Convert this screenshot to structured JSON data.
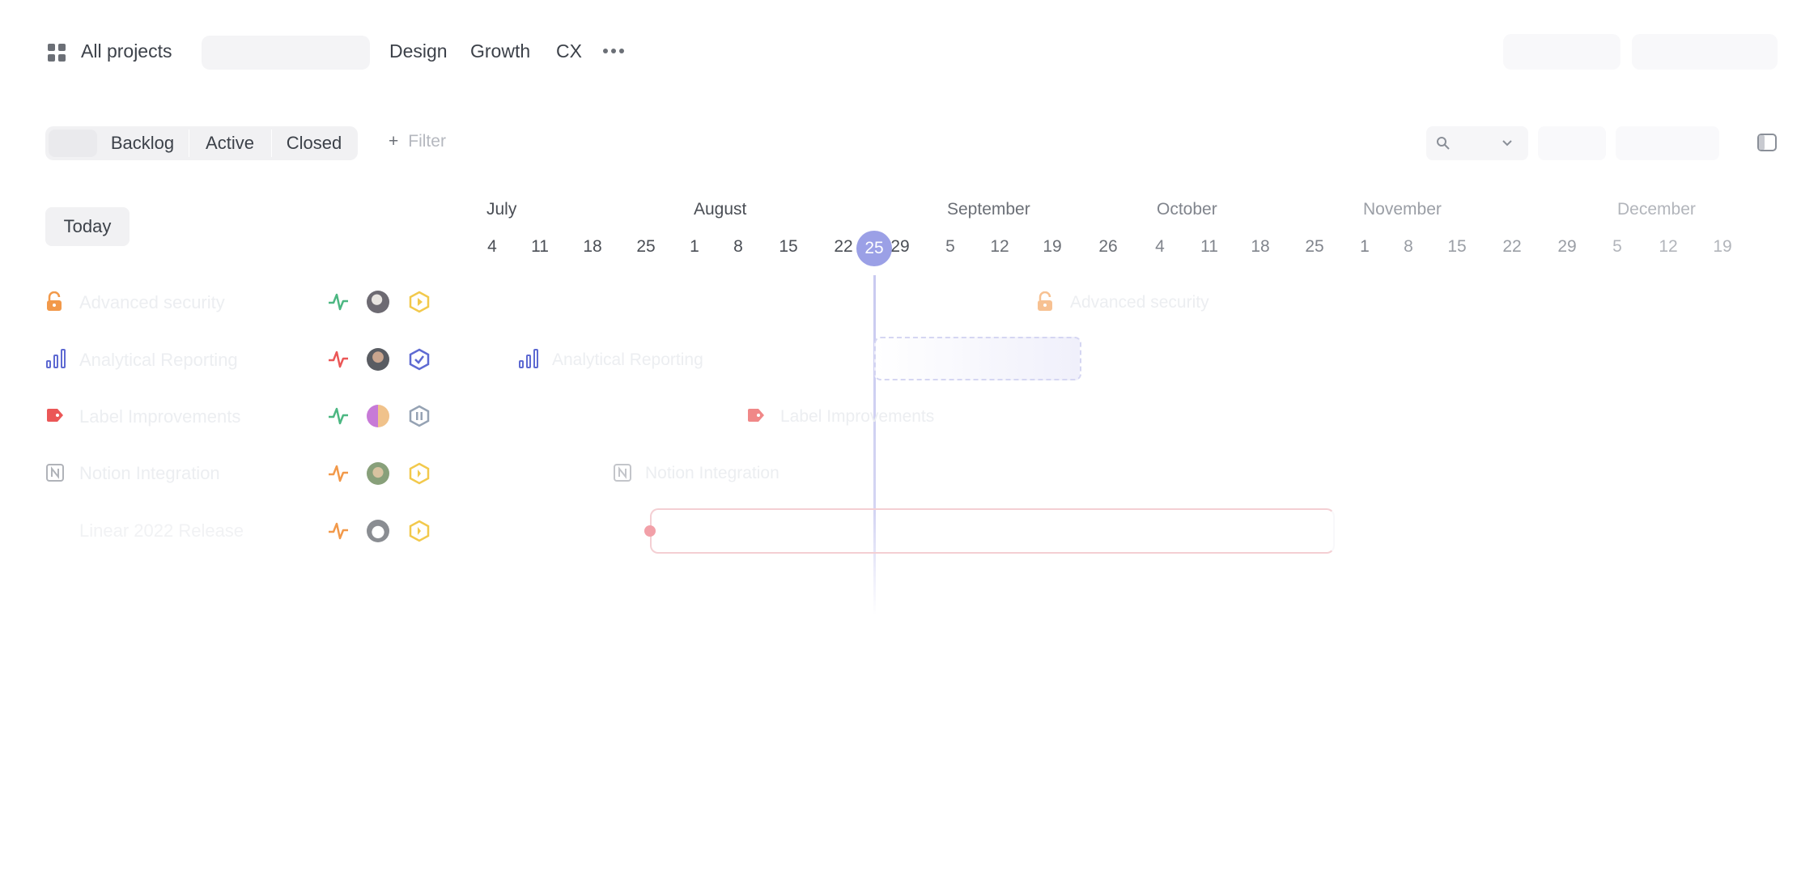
{
  "header": {
    "all_projects_label": "All projects",
    "tabs": [
      "Design",
      "Growth",
      "CX"
    ],
    "more_label": "•••"
  },
  "toolbar": {
    "segments": [
      "Backlog",
      "Active",
      "Closed"
    ],
    "filter_label": "Filter",
    "filter_plus": "+"
  },
  "timeline": {
    "today_button": "Today",
    "months": [
      "July",
      "August",
      "September",
      "October",
      "November",
      "December"
    ],
    "dates": [
      "4",
      "11",
      "18",
      "25",
      "1",
      "8",
      "15",
      "22",
      "25",
      "29",
      "5",
      "12",
      "19",
      "26",
      "4",
      "11",
      "18",
      "25",
      "1",
      "8",
      "15",
      "22",
      "29",
      "5",
      "12",
      "19"
    ],
    "today_label": "25"
  },
  "projects": [
    {
      "name": "Advanced security",
      "icon": "lock-icon",
      "health": "on-track",
      "status": "in-progress"
    },
    {
      "name": "Analytical Reporting",
      "icon": "bar-chart-icon",
      "health": "off-track",
      "status": "completed"
    },
    {
      "name": "Label Improvements",
      "icon": "label-icon",
      "health": "on-track",
      "status": "paused"
    },
    {
      "name": "Notion Integration",
      "icon": "notion-icon",
      "health": "at-risk",
      "status": "in-progress"
    },
    {
      "name": "Linear 2022 Release",
      "icon": "",
      "health": "at-risk",
      "status": "in-progress"
    }
  ],
  "colors": {
    "accent": "#9ba0e6",
    "on_track": "#4cb782",
    "off_track": "#eb5757",
    "at_risk": "#f2994a",
    "status_yellow": "#f2c94c",
    "completed": "#5e6ad2",
    "text": "#3c4149"
  }
}
